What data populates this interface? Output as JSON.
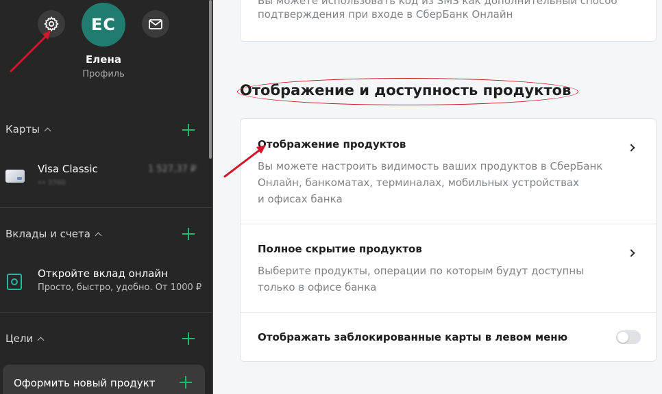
{
  "profile": {
    "initials": "ЕС",
    "name": "Елена",
    "subtitle": "Профиль"
  },
  "icons": {
    "settings": "gear-icon",
    "messages": "envelope-icon"
  },
  "sidebar": {
    "cards_section": {
      "label": "Карты",
      "card": {
        "name": "Visa Classic",
        "amount": "1 527,37 ₽",
        "number": "•• 3700"
      }
    },
    "deposits_section": {
      "label": "Вклады и счета",
      "promo_title": "Откройте вклад онлайн",
      "promo_subtitle": "Просто, быстро, удобно. От 1000 ₽"
    },
    "goals_section": {
      "label": "Цели"
    },
    "new_product_label": "Оформить новый продукт"
  },
  "main": {
    "top_panel_text": [
      "Вы можете использовать код из SMS как дополнительный способ",
      "подтверждения при входе в СберБанк Онлайн"
    ],
    "section_title": "Отображение и доступность продуктов",
    "rows": [
      {
        "title": "Отображение продуктов",
        "desc": [
          "Вы можете настроить видимость ваших продуктов в СберБанк",
          "Онлайн, банкоматах, терминалах, мобильных устройствах",
          "и офисах банка"
        ]
      },
      {
        "title": "Полное скрытие продуктов",
        "desc": [
          "Выберите продукты, операции по которым будут доступны",
          "только в офисе банка"
        ]
      }
    ],
    "toggle_row": {
      "label": "Отображать заблокированные карты в левом меню",
      "enabled": false
    }
  },
  "colors": {
    "sidebar_bg": "#262626",
    "accent_green": "#2fb26b",
    "avatar_bg": "#1f7c6e",
    "annotation_red": "#d0182a"
  }
}
